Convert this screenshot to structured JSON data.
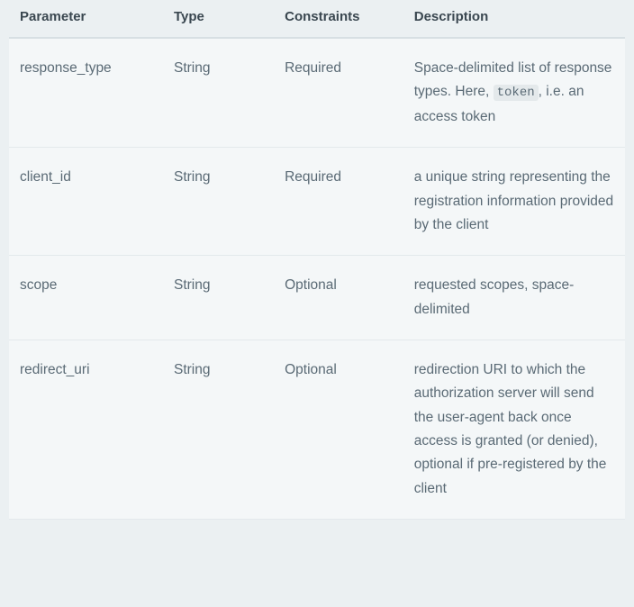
{
  "table": {
    "headers": [
      "Parameter",
      "Type",
      "Constraints",
      "Description"
    ],
    "rows": [
      {
        "parameter": "response_type",
        "type": "String",
        "constraints": "Required",
        "description_pre": "Space-delimited list of response types. Here, ",
        "description_code": "token",
        "description_post": ", i.e. an access token"
      },
      {
        "parameter": "client_id",
        "type": "String",
        "constraints": "Required",
        "description_pre": "a unique string representing the registration information provided by the client",
        "description_code": "",
        "description_post": ""
      },
      {
        "parameter": "scope",
        "type": "String",
        "constraints": "Optional",
        "description_pre": "requested scopes, space-delimited",
        "description_code": "",
        "description_post": ""
      },
      {
        "parameter": "redirect_uri",
        "type": "String",
        "constraints": "Optional",
        "description_pre": "redirection URI to which the authorization server will send the user-agent back once access is granted (or denied), optional if pre-registered by the client",
        "description_code": "",
        "description_post": ""
      }
    ]
  }
}
